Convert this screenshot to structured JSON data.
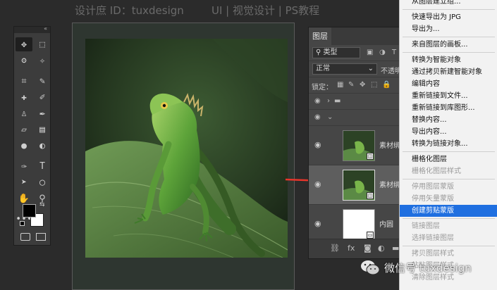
{
  "watermark": {
    "left": "设计庶 ID：tuxdesign",
    "right": "UI | 视觉设计 | PS教程"
  },
  "tools": {
    "collapse_glyph": "«",
    "items": [
      {
        "icon": "move-icon",
        "glyph": "✥"
      },
      {
        "icon": "marquee-icon",
        "glyph": "⬚"
      },
      {
        "icon": "lasso-icon",
        "glyph": "ʘ"
      },
      {
        "icon": "magic-wand-icon",
        "glyph": "✧"
      },
      {
        "icon": "crop-icon",
        "glyph": "⌗"
      },
      {
        "icon": "eyedropper-icon",
        "glyph": "✎"
      },
      {
        "icon": "healing-brush-icon",
        "glyph": "✚"
      },
      {
        "icon": "brush-icon",
        "glyph": "✐"
      },
      {
        "icon": "clone-stamp-icon",
        "glyph": "♙"
      },
      {
        "icon": "history-brush-icon",
        "glyph": "✒"
      },
      {
        "icon": "eraser-icon",
        "glyph": "▱"
      },
      {
        "icon": "gradient-icon",
        "glyph": "▤"
      },
      {
        "icon": "blur-icon",
        "glyph": "●"
      },
      {
        "icon": "dodge-icon",
        "glyph": "◐"
      },
      {
        "icon": "pen-icon",
        "glyph": "✑"
      },
      {
        "icon": "type-icon",
        "glyph": "T"
      },
      {
        "icon": "path-selection-icon",
        "glyph": "➤"
      },
      {
        "icon": "ellipse-icon",
        "glyph": "◯"
      },
      {
        "icon": "hand-icon",
        "glyph": "✋"
      },
      {
        "icon": "zoom-icon",
        "glyph": "⚲"
      },
      {
        "icon": "more-tools-icon",
        "glyph": "•••"
      }
    ],
    "swap_glyph": "⇆",
    "foreground_color": "#000000",
    "background_color": "#ffffff"
  },
  "layers": {
    "tab_label": "图层",
    "filter_label": "类型",
    "blend_mode": "正常",
    "opacity_label": "不透明",
    "lock_label": "锁定：",
    "rows": [
      {
        "name": "素材绑",
        "kind": "smart",
        "selected": false
      },
      {
        "name": "素材绑",
        "kind": "smart",
        "selected": true
      },
      {
        "name": "内圆",
        "kind": "shape",
        "selected": false
      }
    ]
  },
  "context_menu": {
    "items": [
      {
        "label": "从图层建立组...",
        "state": "normal"
      },
      {
        "type": "separator"
      },
      {
        "label": "快速导出为 JPG",
        "state": "normal"
      },
      {
        "label": "导出为...",
        "state": "normal"
      },
      {
        "type": "separator"
      },
      {
        "label": "来自图层的画板...",
        "state": "normal"
      },
      {
        "type": "separator"
      },
      {
        "label": "转换为智能对象",
        "state": "normal"
      },
      {
        "label": "通过拷贝新建智能对象",
        "state": "normal"
      },
      {
        "label": "编辑内容",
        "state": "normal"
      },
      {
        "label": "重新链接到文件...",
        "state": "normal"
      },
      {
        "label": "重新链接到库图形...",
        "state": "normal"
      },
      {
        "label": "替换内容...",
        "state": "normal"
      },
      {
        "label": "导出内容...",
        "state": "normal"
      },
      {
        "label": "转换为链接对象...",
        "state": "normal"
      },
      {
        "type": "separator"
      },
      {
        "label": "栅格化图层",
        "state": "normal"
      },
      {
        "label": "栅格化图层样式",
        "state": "disabled"
      },
      {
        "type": "separator"
      },
      {
        "label": "停用图层蒙版",
        "state": "disabled"
      },
      {
        "label": "停用矢量蒙版",
        "state": "disabled"
      },
      {
        "label": "创建剪贴蒙版",
        "state": "highlighted"
      },
      {
        "type": "separator"
      },
      {
        "label": "链接图层",
        "state": "disabled"
      },
      {
        "label": "选择链接图层",
        "state": "disabled"
      },
      {
        "type": "separator"
      },
      {
        "label": "拷贝图层样式",
        "state": "disabled"
      },
      {
        "label": "粘贴图层样式",
        "state": "disabled"
      },
      {
        "label": "清除图层样式",
        "state": "disabled"
      }
    ]
  },
  "footer": {
    "wechat_text": "微信号 tuxdesign"
  },
  "colors": {
    "menu_highlight": "#1f6fe0",
    "arrow": "#e8352b"
  }
}
